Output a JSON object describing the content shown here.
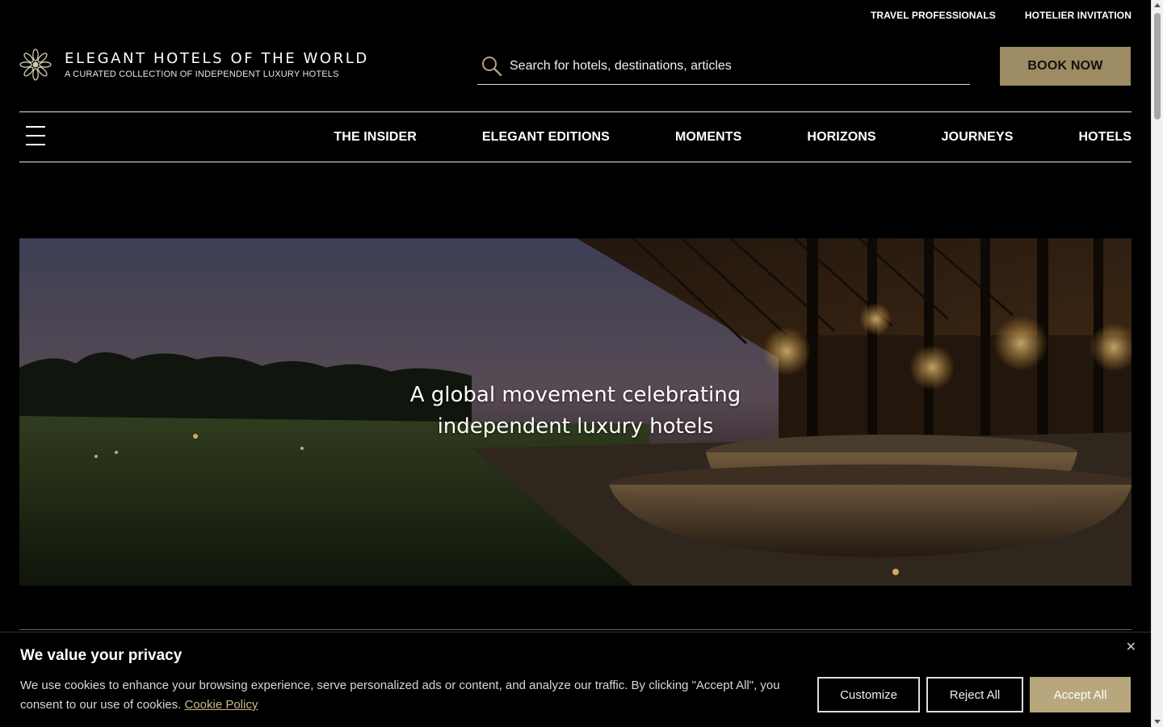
{
  "utility_links": [
    "TRAVEL PROFESSIONALS",
    "HOTELIER INVITATION"
  ],
  "brand": {
    "name": "ELEGANT HOTELS OF THE WORLD",
    "tagline": "A CURATED COLLECTION OF INDEPENDENT LUXURY HOTELS",
    "logo_icon": "sunburst-logo-icon"
  },
  "search": {
    "placeholder": "Search for hotels, destinations, articles",
    "icon": "search-icon"
  },
  "book_now_label": "BOOK NOW",
  "nav": {
    "menu_icon": "hamburger-menu-icon",
    "items": [
      "THE INSIDER",
      "ELEGANT EDITIONS",
      "MOMENTS",
      "HORIZONS",
      "JOURNEYS",
      "HOTELS"
    ]
  },
  "hero": {
    "line1": "A global movement celebrating",
    "line2": "independent luxury hotels"
  },
  "cookie_banner": {
    "title": "We value your privacy",
    "text": "We use cookies to enhance your browsing experience, serve personalized ads or content, and analyze our traffic. By clicking \"Accept All\", you consent to our use of cookies.",
    "policy_link": "Cookie Policy",
    "close_icon": "close-icon",
    "buttons": {
      "customize": "Customize",
      "reject": "Reject All",
      "accept": "Accept All"
    }
  },
  "colors": {
    "background": "#000000",
    "accent_gold": "#9d8b63",
    "accept_button": "#b8a77d"
  }
}
